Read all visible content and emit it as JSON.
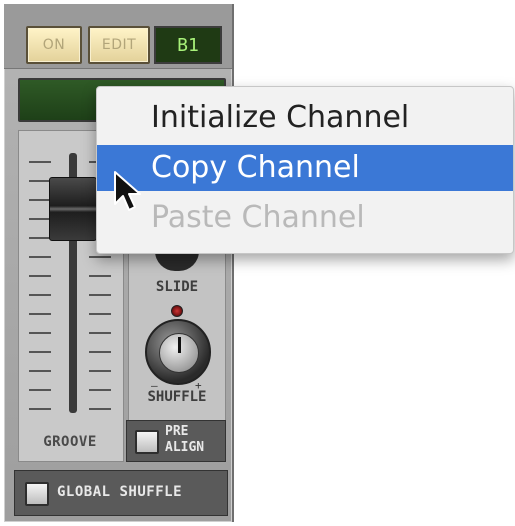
{
  "device": {
    "on_label": "ON",
    "edit_label": "EDIT",
    "channel_display": "B1",
    "groove_label": "GROOVE",
    "slide_label": "SLIDE",
    "shuffle_label": "SHUFFLE",
    "shuffle_min_symbol": "–",
    "shuffle_max_symbol": "+",
    "pre_align_label": "PRE\nALIGN",
    "global_shuffle_label": "GLOBAL SHUFFLE"
  },
  "context_menu": {
    "items": [
      {
        "label": "Initialize Channel",
        "state": "normal"
      },
      {
        "label": "Copy Channel",
        "state": "highlighted"
      },
      {
        "label": "Paste Channel",
        "state": "disabled"
      }
    ]
  },
  "colors": {
    "menu_highlight": "#3b78d6",
    "lcd_text": "#a8f27a",
    "disabled_text": "#b9b9b9"
  }
}
